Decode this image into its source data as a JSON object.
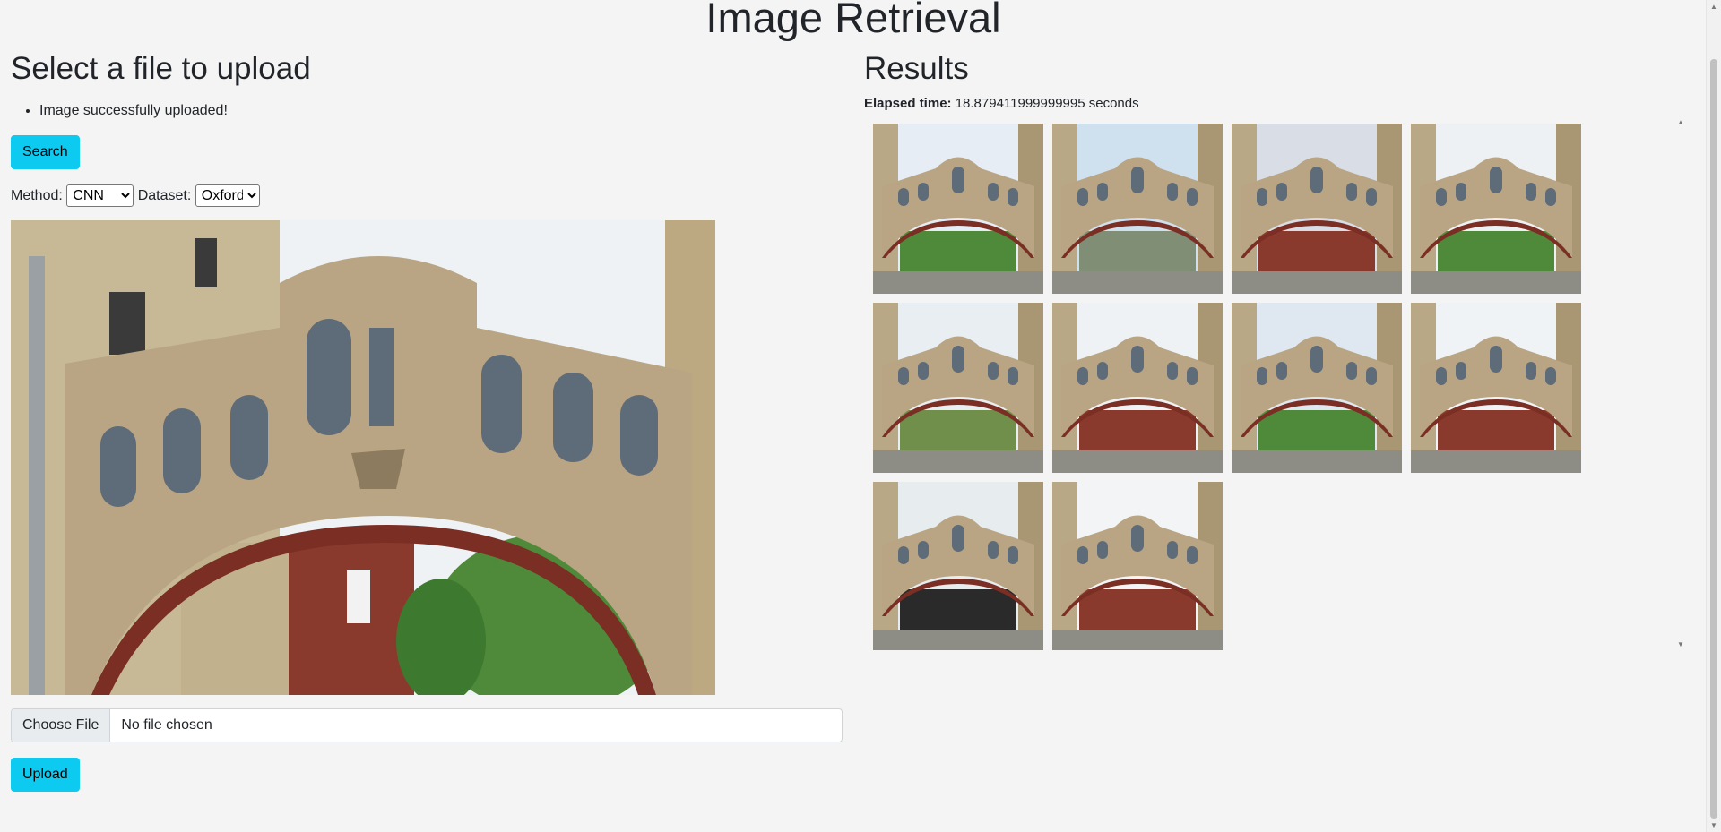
{
  "app": {
    "title": "Image Retrieval"
  },
  "upload": {
    "heading": "Select a file to upload",
    "message": "Image successfully uploaded!",
    "search_label": "Search",
    "method_label": "Method:",
    "method_value": "CNN",
    "dataset_label": "Dataset:",
    "dataset_value": "Oxford",
    "choose_file_label": "Choose File",
    "file_status": "No file chosen",
    "upload_label": "Upload"
  },
  "results": {
    "heading": "Results",
    "elapsed_label": "Elapsed time:",
    "elapsed_value": "18.879411999999995 seconds",
    "thumbnail_count": 10
  },
  "colors": {
    "accent": "#0dcaf0",
    "background": "#f4f4f4",
    "stone": "#b9a583",
    "sky": "#eaf0f6",
    "brick": "#8a3a2c",
    "foliage": "#4f8a3a"
  }
}
